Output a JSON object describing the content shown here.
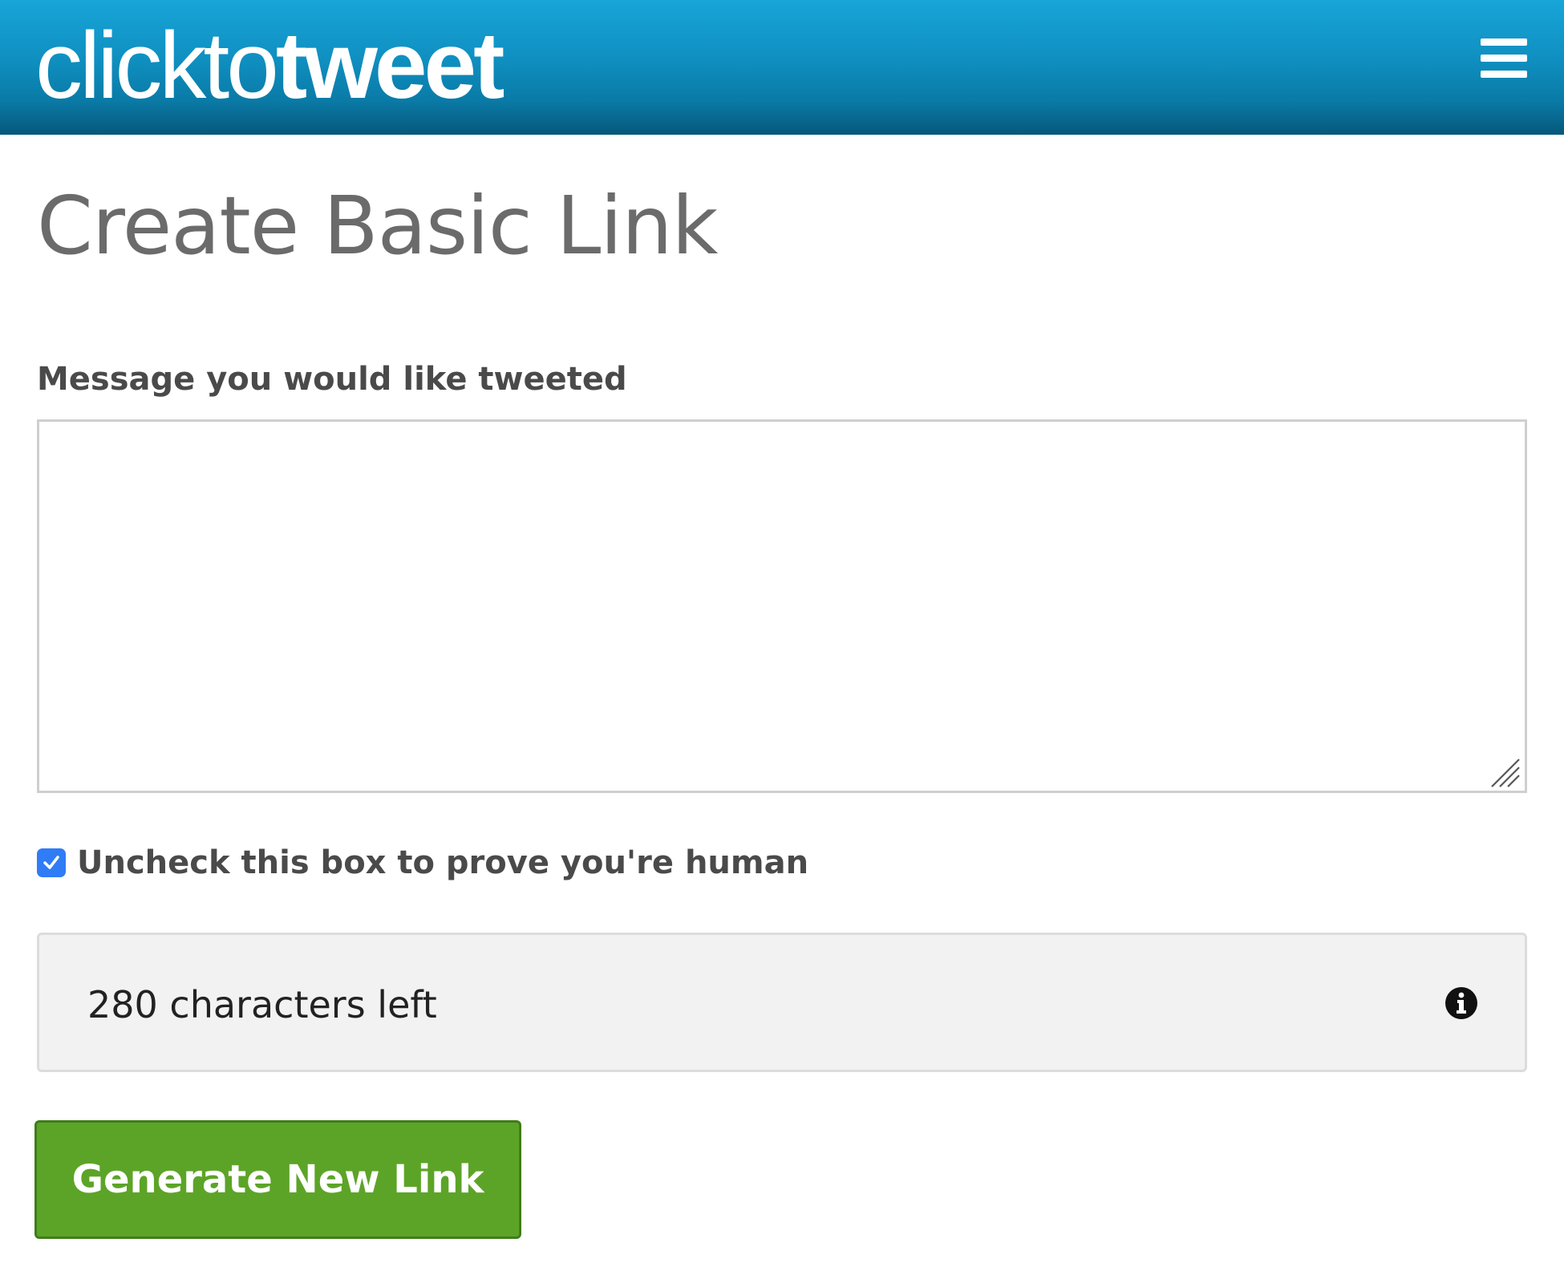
{
  "header": {
    "logo_light": "clickto",
    "logo_bold": "tweet",
    "background": "#0f8fc0",
    "menu_icon": "hamburger-menu-icon"
  },
  "main": {
    "page_title": "Create Basic Link",
    "message_label": "Message you would like tweeted",
    "message_value": "",
    "human_check": {
      "label": "Uncheck this box to prove you're human",
      "checked": true,
      "color": "#2f7cf6"
    },
    "counter": {
      "text": "280 characters left",
      "icon": "info-circle-icon"
    },
    "generate_button": {
      "label": "Generate New Link",
      "color": "#5ca427"
    }
  }
}
